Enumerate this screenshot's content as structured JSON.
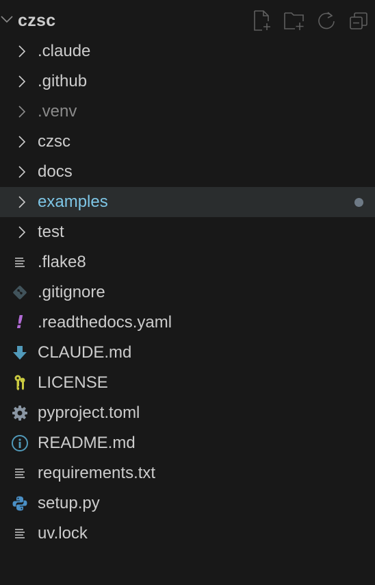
{
  "header": {
    "title": "czsc",
    "actions": [
      {
        "name": "new-file-icon"
      },
      {
        "name": "new-folder-icon"
      },
      {
        "name": "refresh-icon"
      },
      {
        "name": "collapse-all-icon"
      }
    ]
  },
  "folders": [
    {
      "label": ".claude",
      "state": "normal"
    },
    {
      "label": ".github",
      "state": "normal"
    },
    {
      "label": ".venv",
      "state": "ignored"
    },
    {
      "label": "czsc",
      "state": "normal"
    },
    {
      "label": "docs",
      "state": "normal"
    },
    {
      "label": "examples",
      "state": "modified"
    },
    {
      "label": "test",
      "state": "normal"
    }
  ],
  "files": [
    {
      "label": ".flake8",
      "icon": "lines-file-icon",
      "color": "#cccccc"
    },
    {
      "label": ".gitignore",
      "icon": "git-icon",
      "color": "#41535b"
    },
    {
      "label": ".readthedocs.yaml",
      "icon": "exclamation-icon",
      "color": "#b26bd6"
    },
    {
      "label": "CLAUDE.md",
      "icon": "download-arrow-icon",
      "color": "#519aba"
    },
    {
      "label": "LICENSE",
      "icon": "key-icon",
      "color": "#cbcb41"
    },
    {
      "label": "pyproject.toml",
      "icon": "gear-icon",
      "color": "#8a96a3"
    },
    {
      "label": "README.md",
      "icon": "info-icon",
      "color": "#519aba"
    },
    {
      "label": "requirements.txt",
      "icon": "lines-file-icon",
      "color": "#cccccc"
    },
    {
      "label": "setup.py",
      "icon": "python-icon",
      "color": "#4a8fc5"
    },
    {
      "label": "uv.lock",
      "icon": "lines-file-icon",
      "color": "#cccccc"
    }
  ],
  "colors": {
    "background": "#181818",
    "selected_row": "#2a2d2e",
    "text": "#cccccc",
    "ignored_text": "#8b8b8b",
    "modified_text": "#7ec6e6",
    "modified_dot": "#6e7a86"
  }
}
